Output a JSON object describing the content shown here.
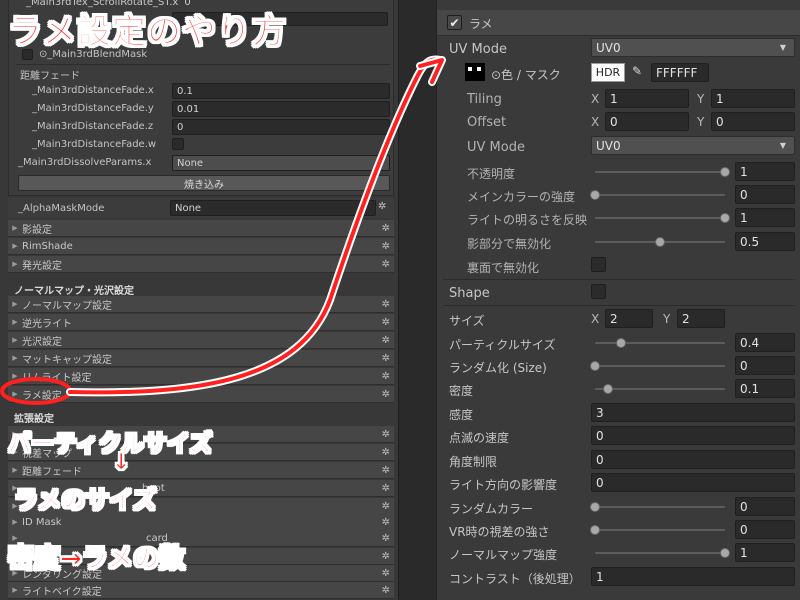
{
  "annotations": {
    "title": "ラメ設定のやり方",
    "particle_size": "パーティクルサイズ",
    "lame_size": "ラメのサイズ",
    "density": "密度→ラメの数",
    "arrow_down": "↓"
  },
  "left": {
    "cut_top_label": "_Main3rdTex_ScrollRotate_ST.x",
    "cut_top_value": "0",
    "blend_mask": "⊙_Main3rdBlendMask",
    "distance_fade_header": "距離フェード",
    "fade_rows": [
      {
        "label": "_Main3rdDistanceFade.x",
        "value": "0.1"
      },
      {
        "label": "_Main3rdDistanceFade.y",
        "value": "0.01"
      },
      {
        "label": "_Main3rdDistanceFade.z",
        "value": "0"
      },
      {
        "label": "_Main3rdDistanceFade.w",
        "value": ""
      }
    ],
    "dissolve_label": "_Main3rdDissolveParams.x",
    "dissolve_value": "None",
    "bake_button": "焼き込み",
    "alpha_mask_label": "_AlphaMaskMode",
    "alpha_mask_value": "None",
    "folds_1": [
      "影設定",
      "RimShade",
      "発光設定"
    ],
    "section_normal": "ノーマルマップ・光沢設定",
    "folds_2": [
      "ノーマルマップ設定",
      "逆光ライト",
      "光沢設定",
      "マットキャップ設定",
      "リムライト設定",
      "ラメ設定"
    ],
    "section_ext": "拡張設定",
    "folds_3": [
      "",
      "視差マップ",
      "距離フェード",
      "",
      "",
      "ID Mask",
      "",
      "",
      "レンダリング設定",
      "ライトベイク設定"
    ],
    "fold3_partial_1": "hapt",
    "fold3_partial_2": "card"
  },
  "right": {
    "header_label": "ラメ",
    "uv_mode_label": "UV Mode",
    "uv_mode_value": "UV0",
    "color_mask_label": "⊙色 / マスク",
    "hdr_label": "HDR",
    "hex_value": "FFFFFF",
    "tiling_label": "Tiling",
    "tiling_x": "1",
    "tiling_y": "1",
    "offset_label": "Offset",
    "offset_x": "0",
    "offset_y": "0",
    "uv_mode2_label": "UV Mode",
    "uv_mode2_value": "UV0",
    "sliders_top": [
      {
        "label": "不透明度",
        "value": "1",
        "level": 1.0
      },
      {
        "label": "メインカラーの強度",
        "value": "0",
        "level": 0.0
      },
      {
        "label": "ライトの明るさを反映",
        "value": "1",
        "level": 1.0
      },
      {
        "label": "影部分で無効化",
        "value": "0.5",
        "level": 0.5
      }
    ],
    "back_disable_label": "裏面で無効化",
    "shape_label": "Shape",
    "size_label": "サイズ",
    "size_x": "2",
    "size_y": "2",
    "sliders_bottom": [
      {
        "label": "パーティクルサイズ",
        "value": "0.4",
        "level": 0.2
      },
      {
        "label": "ランダム化 (Size)",
        "value": "0",
        "level": 0.0
      },
      {
        "label": "密度",
        "value": "0.1",
        "level": 0.1
      }
    ],
    "fields": [
      {
        "label": "感度",
        "value": "3"
      },
      {
        "label": "点滅の速度",
        "value": "0"
      },
      {
        "label": "角度制限",
        "value": "0"
      },
      {
        "label": "ライト方向の影響度",
        "value": "0"
      }
    ],
    "sliders_last": [
      {
        "label": "ランダムカラー",
        "value": "0",
        "level": 0.0
      },
      {
        "label": "VR時の視差の強さ",
        "value": "0",
        "level": 0.0
      },
      {
        "label": "ノーマルマップ強度",
        "value": "1",
        "level": 1.0
      }
    ],
    "contrast_label": "コントラスト（後処理）",
    "contrast_value": "1",
    "axis_x": "X",
    "axis_y": "Y"
  },
  "colors": {
    "annotation_red": "#ff2626",
    "annotation_outline": "#ffffff",
    "panel_bg": "#383838",
    "field_bg": "#2a2a2a"
  }
}
